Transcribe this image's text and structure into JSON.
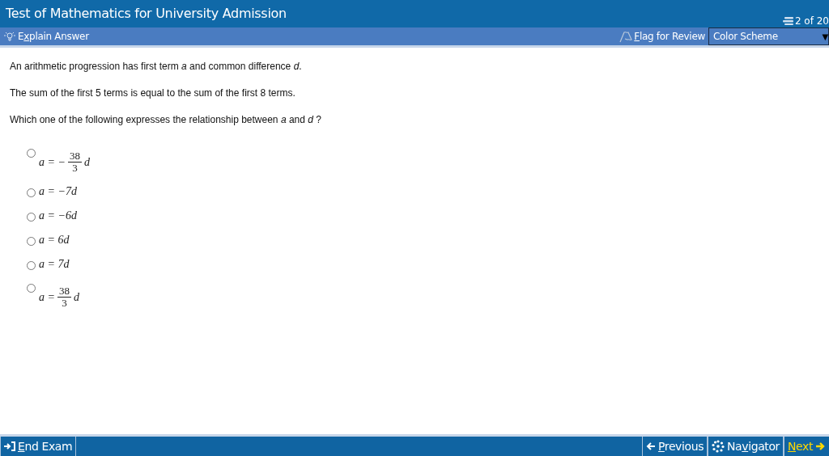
{
  "window": {
    "title": "Test of Mathematics for University Admission",
    "counter": "2 of 20"
  },
  "toolbar": {
    "explain": {
      "before": "E",
      "underlined": "x",
      "after": "plain Answer"
    },
    "flag": {
      "underlined": "F",
      "after": "lag for Review"
    },
    "color_scheme": {
      "value": "Color Scheme",
      "arrow": "▼"
    }
  },
  "question": [
    "An arithmetic progression has first term *a* and common difference *d*.",
    "The sum of the first 5 terms is equal to the sum of the first 8 terms.",
    "Which one of the following expresses the relationship between *a* and *d* ?"
  ],
  "options": [
    {
      "kind": "fraction",
      "selected": false,
      "lhs": "a =",
      "sign": "−",
      "numerator": "38",
      "denominator": "3",
      "rhs": "d"
    },
    {
      "kind": "inline",
      "selected": false,
      "text": "a = −7d"
    },
    {
      "kind": "inline",
      "selected": false,
      "text": "a = −6d"
    },
    {
      "kind": "inline",
      "selected": false,
      "text": "a = 6d"
    },
    {
      "kind": "inline",
      "selected": false,
      "text": "a = 7d"
    },
    {
      "kind": "fraction",
      "selected": false,
      "lhs": "a =",
      "numerator": "38",
      "denominator": "3",
      "rhs": "d"
    }
  ],
  "footer": {
    "end": {
      "underlined": "E",
      "after": "nd Exam"
    },
    "previous": {
      "underlined": "P",
      "after": "revious"
    },
    "navigator": {
      "before": "Na",
      "underlined": "v",
      "after": "igator"
    },
    "next": {
      "underlined": "N",
      "after": "ext"
    }
  }
}
